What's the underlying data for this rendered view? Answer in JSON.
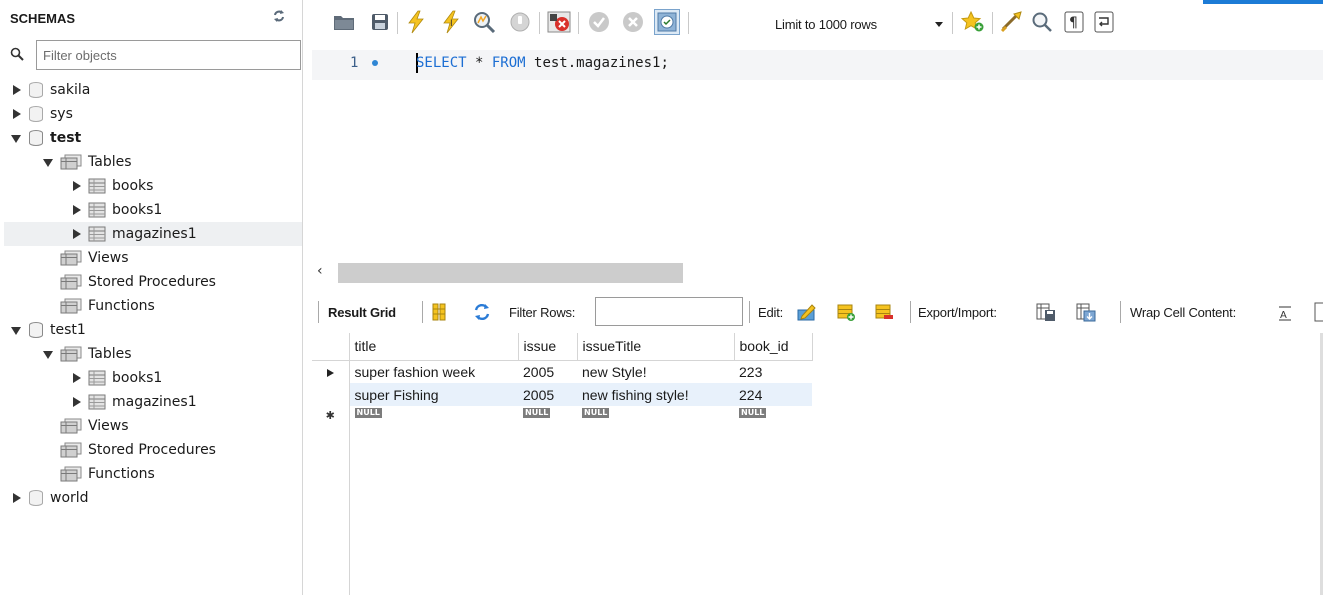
{
  "schemas_panel": {
    "title": "SCHEMAS",
    "filter_placeholder": "Filter objects",
    "tree": {
      "sakila": "sakila",
      "sys": "sys",
      "test": "test",
      "test_tables": "Tables",
      "test_books": "books",
      "test_books1": "books1",
      "test_magazines1": "magazines1",
      "test_views": "Views",
      "test_stored_procedures": "Stored Procedures",
      "test_functions": "Functions",
      "test1": "test1",
      "test1_tables": "Tables",
      "test1_books1": "books1",
      "test1_magazines1": "magazines1",
      "test1_views": "Views",
      "test1_stored_procedures": "Stored Procedures",
      "test1_functions": "Functions",
      "world": "world"
    }
  },
  "toolbar": {
    "limit_label": "Limit to 1000 rows",
    "icons": [
      "open-folder-icon",
      "save-icon",
      "execute-icon",
      "execute-current-icon",
      "explain-icon",
      "stop-icon",
      "toggle-error-icon",
      "commit-icon",
      "rollback-icon",
      "autocommit-icon",
      "bookmark-icon",
      "beautify-icon",
      "find-icon",
      "invisibles-icon",
      "wrap-icon"
    ]
  },
  "editor": {
    "line_number": "1",
    "sql_keyword_select": "SELECT",
    "sql_middle": " * ",
    "sql_keyword_from": "FROM",
    "sql_rest": " test.magazines1;"
  },
  "result_toolbar": {
    "result_grid_label": "Result Grid",
    "filter_rows_label": "Filter Rows:",
    "filter_rows_value": "",
    "edit_label": "Edit:",
    "export_import_label": "Export/Import:",
    "wrap_cell_label": "Wrap Cell Content:"
  },
  "result_grid": {
    "columns": [
      "title",
      "issue",
      "issueTitle",
      "book_id"
    ],
    "rows": [
      [
        "super fashion week",
        "2005",
        "new Style!",
        "223"
      ],
      [
        "super Fishing",
        "2005",
        "new  fishing style!",
        "224"
      ]
    ],
    "new_row_values": [
      "NULL",
      "NULL",
      "NULL",
      "NULL"
    ]
  },
  "colors": {
    "accent": "#1c7bd6",
    "keyword": "#1c6ed3",
    "selected_row": "#e8f1fb",
    "null_badge": "#7c7c7c"
  }
}
